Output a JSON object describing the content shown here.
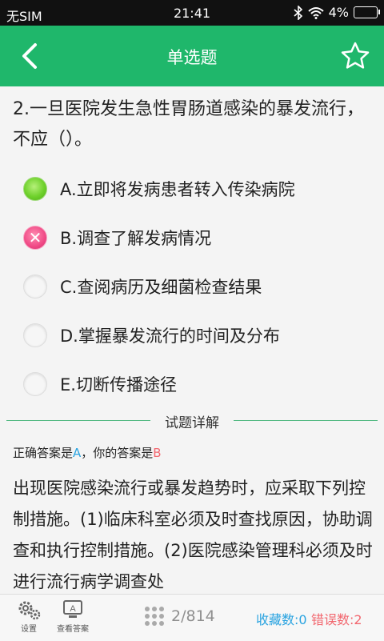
{
  "status_bar": {
    "carrier": "无SIM",
    "time": "21:41",
    "battery": "4%"
  },
  "header": {
    "title": "单选题",
    "back_icon": "back-chevron-icon",
    "favorite_icon": "star-outline-icon"
  },
  "question": {
    "text": "2.一旦医院发生急性胃肠道感染的暴发流行，不应（）。",
    "options": [
      {
        "label": "A.立即将发病患者转入传染病院",
        "state": "correct"
      },
      {
        "label": "B.调查了解发病情况",
        "state": "wrong"
      },
      {
        "label": "C.查阅病历及细菌检查结果",
        "state": "empty"
      },
      {
        "label": "D.掌握暴发流行的时间及分布",
        "state": "empty"
      },
      {
        "label": "E.切断传播途径",
        "state": "empty"
      }
    ]
  },
  "detail": {
    "section_title": "试题详解",
    "correct_prefix": "正确答案是",
    "correct_answer": "A",
    "your_prefix": "，你的答案是",
    "your_answer": "B",
    "explanation": "出现医院感染流行或暴发趋势时，应采取下列控制措施。(1)临床科室必须及时查找原因，协助调查和执行控制措施。(2)医院感染管理科必须及时进行流行病学调查处"
  },
  "bottom_bar": {
    "settings_label": "设置",
    "view_answer_label": "查看答案",
    "page": "2/814",
    "favorites": "收藏数:0",
    "errors": "错误数:2"
  },
  "colors": {
    "header_bg": "#1fb76b",
    "correct_blue": "#29a3e0",
    "wrong_red": "#f2676f"
  }
}
